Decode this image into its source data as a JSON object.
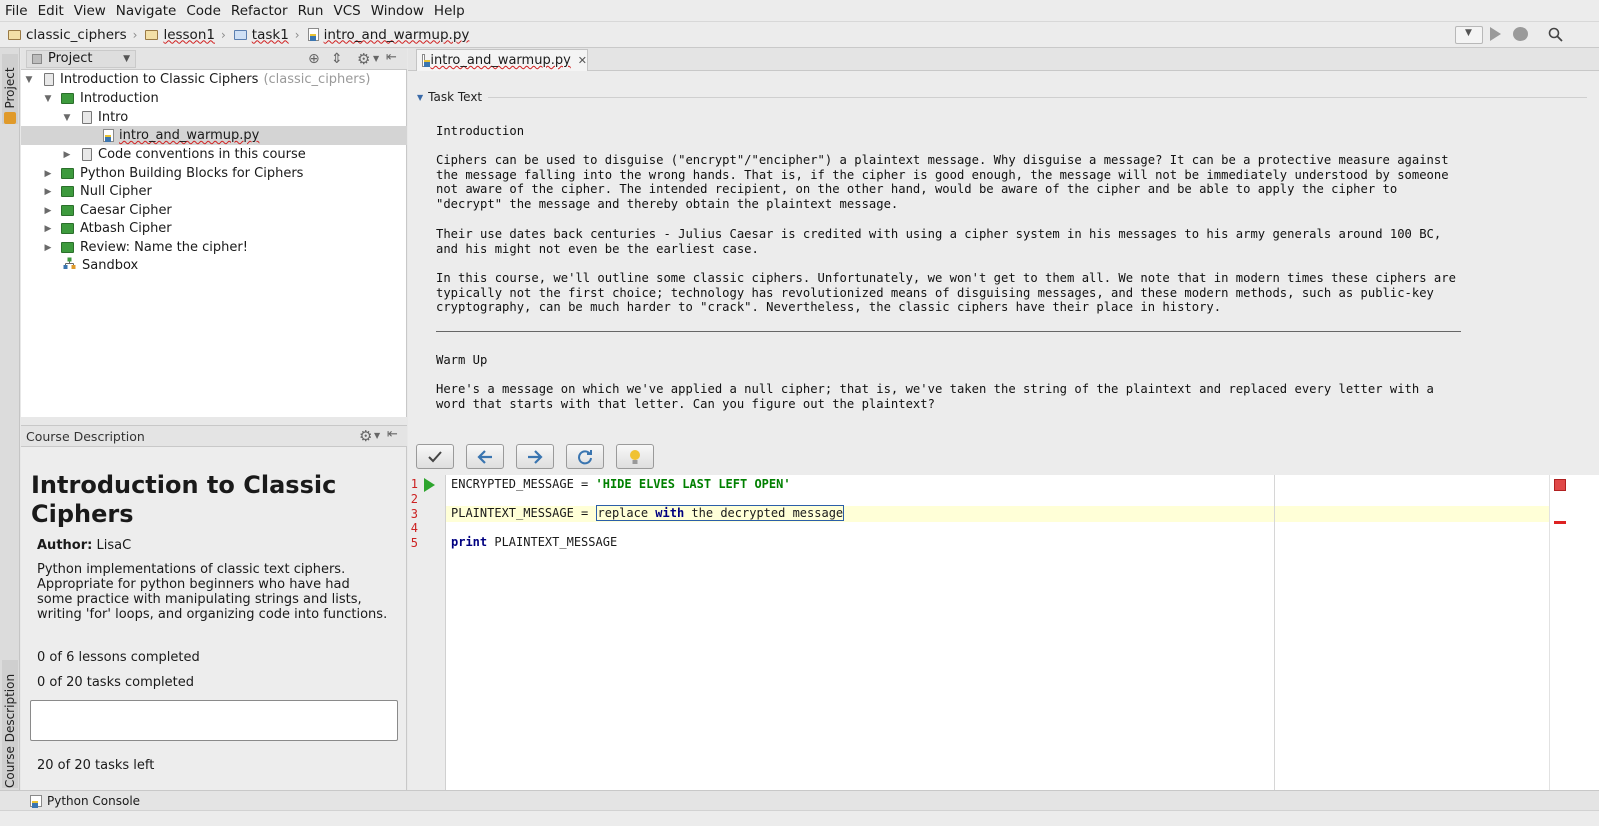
{
  "menu": [
    "File",
    "Edit",
    "View",
    "Navigate",
    "Code",
    "Refactor",
    "Run",
    "VCS",
    "Window",
    "Help"
  ],
  "breadcrumb": [
    "classic_ciphers",
    "lesson1",
    "task1",
    "intro_and_warmup.py"
  ],
  "left_strip": {
    "project_label": "1: Project",
    "course_label": "Course Description"
  },
  "project_panel": {
    "title": "Project",
    "tree": [
      {
        "label": "Introduction to Classic Ciphers",
        "hint": "(classic_ciphers)",
        "depth": 0,
        "arrow": "down",
        "icon": "clip"
      },
      {
        "label": "Introduction",
        "depth": 1,
        "arrow": "down",
        "icon": "board"
      },
      {
        "label": "Intro",
        "depth": 2,
        "arrow": "down",
        "icon": "clip"
      },
      {
        "label": "intro_and_warmup.py",
        "depth": 3,
        "arrow": "none",
        "icon": "py",
        "selected": true
      },
      {
        "label": "Code conventions in this course",
        "depth": 2,
        "arrow": "right",
        "icon": "clip"
      },
      {
        "label": "Python Building Blocks for Ciphers",
        "depth": 1,
        "arrow": "right",
        "icon": "board"
      },
      {
        "label": "Null Cipher",
        "depth": 1,
        "arrow": "right",
        "icon": "board"
      },
      {
        "label": "Caesar Cipher",
        "depth": 1,
        "arrow": "right",
        "icon": "board"
      },
      {
        "label": "Atbash Cipher",
        "depth": 1,
        "arrow": "right",
        "icon": "board"
      },
      {
        "label": "Review: Name the cipher!",
        "depth": 1,
        "arrow": "right",
        "icon": "board"
      },
      {
        "label": "Sandbox",
        "depth": 1,
        "arrow": "none",
        "icon": "sandbox"
      }
    ]
  },
  "course_description": {
    "panel_title": "Course Description",
    "title": "Introduction to Classic Ciphers",
    "author_label": "Author:",
    "author": "LisaC",
    "description": "Python implementations of classic text ciphers. Appropriate for python beginners who have had some practice with manipulating strings and lists, writing 'for' loops, and organizing code into functions.",
    "lessons_completed": "0 of 6 lessons completed",
    "tasks_completed": "0 of 20 tasks completed",
    "progress": 0,
    "tasks_left": "20 of 20 tasks left"
  },
  "editor_tab": "intro_and_warmup.py",
  "task_text": {
    "section_label": "Task Text",
    "heading1": "Introduction",
    "p1": "Ciphers can be used to disguise (\"encrypt\"/\"encipher\") a plaintext message. Why disguise a message? It can be a protective measure against the message falling into the wrong hands. That is, if the cipher is good enough, the message will not be immediately understood by someone not aware of the cipher. The intended recipient, on the other hand, would be aware of the cipher and be able to apply the cipher to \"decrypt\" the message and thereby obtain the plaintext message.",
    "p2": "Their use dates back centuries - Julius Caesar is credited with using a cipher system in his messages to his army generals around 100 BC, and his might not even be the earliest case.",
    "p3": "In this course, we'll outline some classic ciphers. Unfortunately, we won't get to them all. We note that in modern times these ciphers are typically not the first choice; technology has revolutionized means of disguising messages, and these modern methods, such as public-key cryptography, can be much harder to \"crack\". Nevertheless, the classic ciphers have their place in history.",
    "heading2": "Warm Up",
    "p4": "Here's a message on which we've applied a null cipher; that is, we've taken the string of the plaintext and replaced every letter with a word that starts with that letter. Can you figure out the plaintext?"
  },
  "code": {
    "line_numbers": [
      "1",
      "2",
      "3",
      "4",
      "5"
    ],
    "l1_var": "ENCRYPTED_MESSAGE = ",
    "l1_str": "'HIDE ELVES LAST LEFT OPEN'",
    "l3_var": "PLAINTEXT_MESSAGE = ",
    "l3_ph1": "replace ",
    "l3_kw": "with",
    "l3_ph2": " the decrypted message",
    "l5_kw": "print",
    "l5_rest": " PLAINTEXT_MESSAGE"
  },
  "status": {
    "console": "Python Console"
  },
  "colors": {
    "accent": "#2b5ea8",
    "string": "#008000",
    "keyword": "#000080",
    "error_line": "#c22",
    "caret_row": "#ffffd7"
  }
}
